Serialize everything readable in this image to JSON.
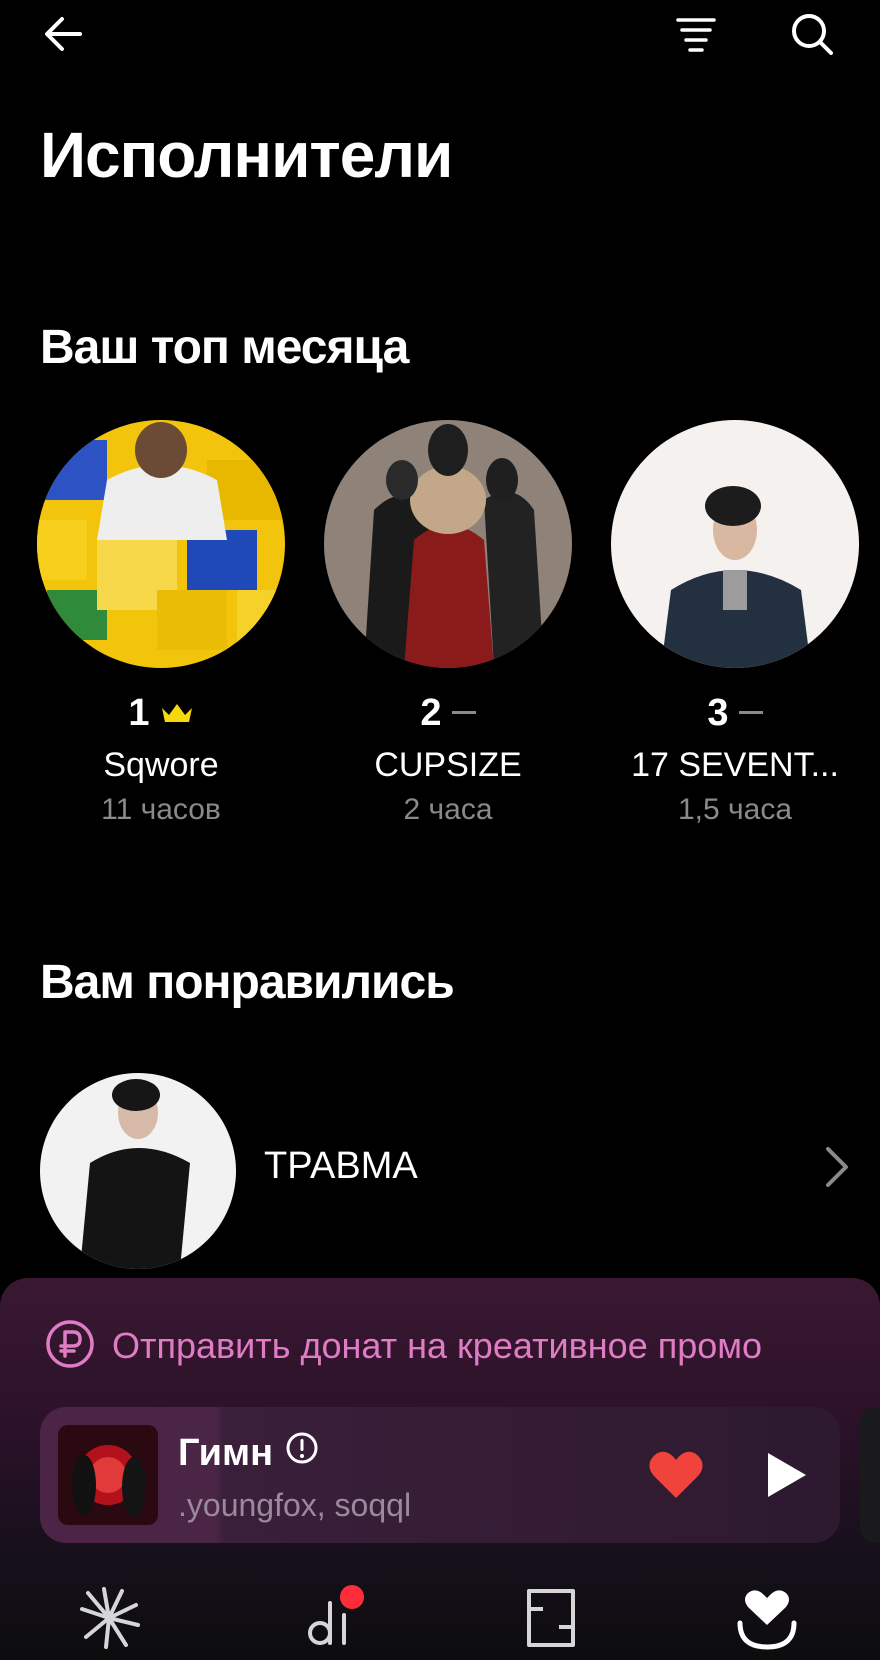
{
  "header": {
    "back_icon": "arrow-left-icon",
    "filter_icon": "sort-lines-icon",
    "search_icon": "search-icon",
    "title": "Исполнители"
  },
  "top_month": {
    "title": "Ваш топ месяца",
    "artists": [
      {
        "rank": "1",
        "rank_mark": "crown-icon",
        "name": "Sqwore",
        "time": "11 часов"
      },
      {
        "rank": "2",
        "rank_mark": "dash",
        "name": "CUPSIZE",
        "time": "2 часа"
      },
      {
        "rank": "3",
        "rank_mark": "dash",
        "name": "17 SEVENT...",
        "time": "1,5 часа"
      }
    ]
  },
  "liked": {
    "title": "Вам понравились",
    "items": [
      {
        "name": "ТРАВМА"
      }
    ]
  },
  "promo": {
    "donate_label": "Отправить донат на креативное промо"
  },
  "player": {
    "title": "Гимн",
    "artists": ".youngfox, soqql",
    "explicit_icon": "explicit-icon",
    "liked": true,
    "progress": 0.23
  },
  "tabs": [
    {
      "name": "wave",
      "icon": "spark-icon"
    },
    {
      "name": "podcasts",
      "icon": "podcast-icon",
      "badge": true
    },
    {
      "name": "books",
      "icon": "book-icon"
    },
    {
      "name": "collection",
      "icon": "heart-collection-icon",
      "active": true
    }
  ],
  "colors": {
    "accent_pink": "#e07cc4",
    "crown": "#f5d90a",
    "heart": "#f0433b",
    "badge": "#ff2d3a",
    "muted": "#8a8a8a"
  }
}
